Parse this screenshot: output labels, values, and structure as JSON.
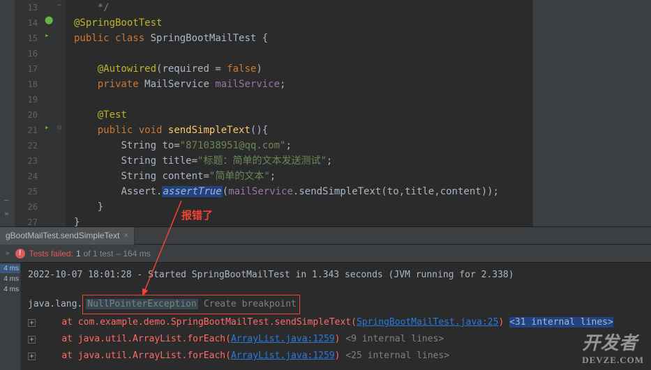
{
  "editor": {
    "lines": {
      "13": "*/",
      "14": "@SpringBootTest",
      "15_public": "public",
      "15_class": "class",
      "15_name": "SpringBootMailTest",
      "17_anno": "@Autowired",
      "17_req": "required",
      "17_false": "false",
      "18_private": "private",
      "18_type": "MailService",
      "18_field": "mailService",
      "20_test": "@Test",
      "21_public": "public",
      "21_void": "void",
      "21_method": "sendSimpleText",
      "22_type": "String",
      "22_var": "to",
      "22_val": "\"871038951@qq.com\"",
      "23_type": "String",
      "23_var": "title",
      "23_val": "\"标题：简单的文本发送测试\"",
      "24_type": "String",
      "24_var": "content",
      "24_val": "\"简单的文本\"",
      "25_assert": "Assert",
      "25_method": "assertTrue",
      "25_field": "mailService",
      "25_call": "sendSimpleText",
      "25_args": [
        "to",
        "title",
        "content"
      ]
    },
    "line_numbers": [
      "13",
      "14",
      "15",
      "16",
      "17",
      "18",
      "19",
      "20",
      "21",
      "22",
      "23",
      "24",
      "25",
      "26",
      "27"
    ]
  },
  "annotation": {
    "label": "报错了"
  },
  "run_tab": {
    "title": "gBootMailTest.sendSimpleText"
  },
  "test_status": {
    "label": "Tests failed:",
    "count": "1",
    "of": "of 1 test",
    "time": "– 164 ms"
  },
  "timings": [
    "4 ms",
    "4 ms",
    "4 ms"
  ],
  "console": {
    "line1": "2022-10-07 18:01:28 - Started SpringBootMailTest in 1.343 seconds (JVM running for 2.338)",
    "npe_prefix": "java.lang.",
    "npe": "NullPointerException",
    "breakpoint": "Create breakpoint",
    "frame1_pre": "at com.example.demo.SpringBootMailTest.sendSimpleText(",
    "frame1_link": "SpringBootMailTest.java:25",
    "frame1_suf": ")",
    "frame1_fold": "<31 internal lines>",
    "frame2_pre": "at java.util.ArrayList.forEach(",
    "frame2_link": "ArrayList.java:1259",
    "frame2_suf": ")",
    "frame2_fold": "<9 internal lines>",
    "frame3_pre": "at java.util.ArrayList.forEach(",
    "frame3_link": "ArrayList.java:1259",
    "frame3_suf": ")",
    "frame3_fold": "<25 internal lines>"
  },
  "watermark": {
    "main": "开发者",
    "sub": "DEVZE.COM"
  }
}
